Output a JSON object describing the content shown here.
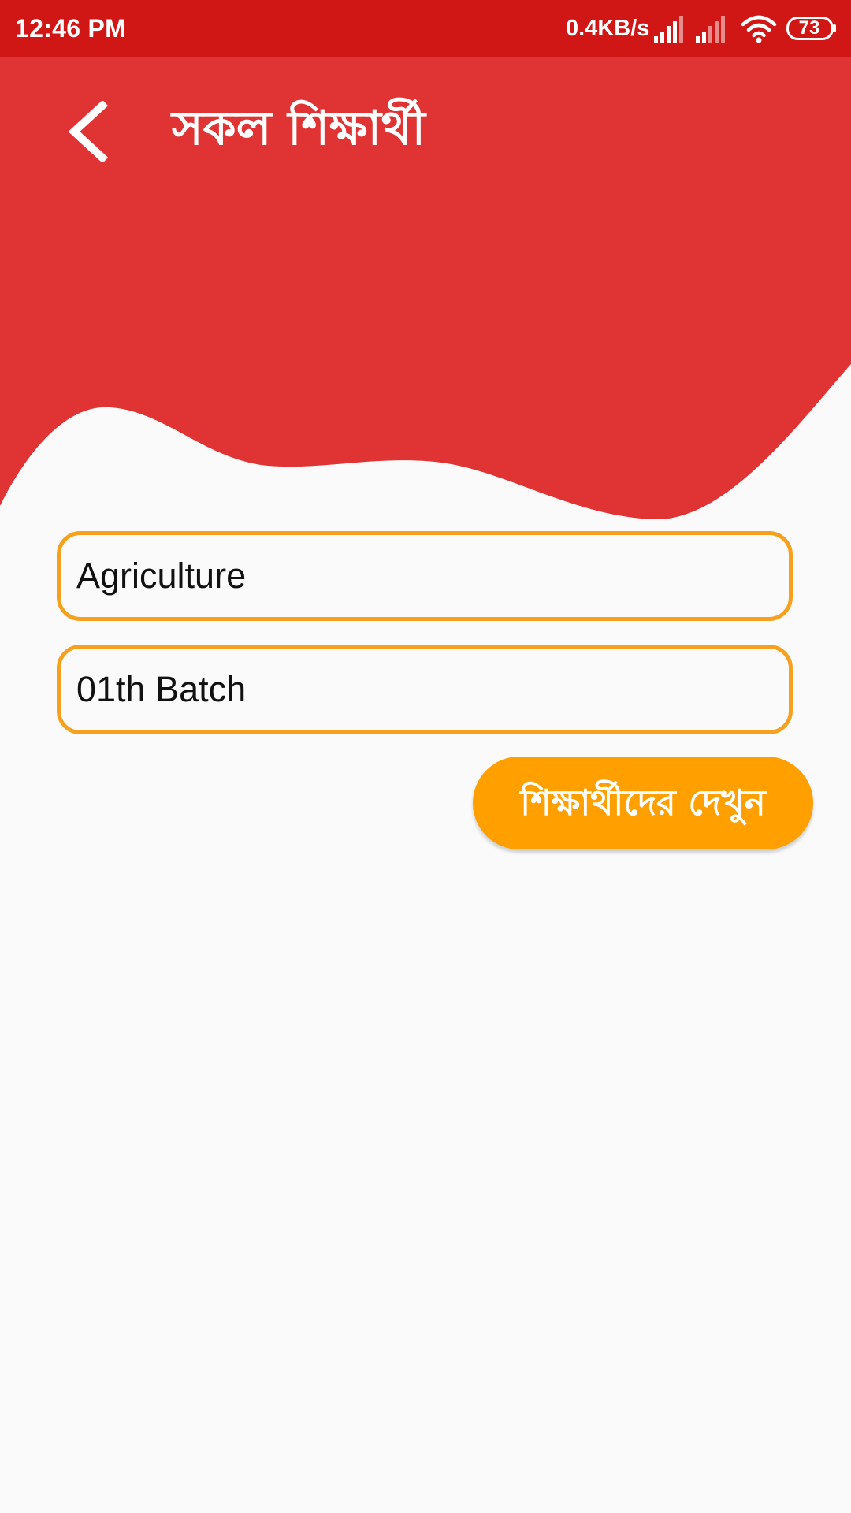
{
  "status_bar": {
    "time": "12:46 PM",
    "network_speed": "0.4KB/s",
    "battery_level": "73",
    "icons": [
      "signal-icon",
      "signal-icon",
      "wifi-icon",
      "battery-icon"
    ]
  },
  "header": {
    "title": "সকল শিক্ষার্থী",
    "back_icon": "back-arrow-icon",
    "color": "#e03434"
  },
  "form": {
    "department_value": "Agriculture",
    "batch_value": "01th Batch",
    "border_color": "#f5a11e"
  },
  "actions": {
    "view_students_label": "শিক্ষার্থীদের দেখুন",
    "button_color": "#ffa000"
  }
}
